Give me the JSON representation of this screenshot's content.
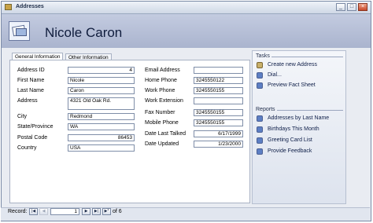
{
  "window": {
    "title": "Addresses"
  },
  "header": {
    "contact_name": "Nicole Caron"
  },
  "tabs": {
    "general": "General Information",
    "other": "Other Information"
  },
  "form_left": [
    {
      "label": "Address ID",
      "value": "4",
      "numeric": true
    },
    {
      "label": "First Name",
      "value": "Nicole"
    },
    {
      "label": "Last Name",
      "value": "Caron"
    },
    {
      "label": "Address",
      "value": "4321 Old Oak Rd."
    },
    {
      "label": "City",
      "value": "Redmond"
    },
    {
      "label": "State/Province",
      "value": "WA"
    },
    {
      "label": "Postal Code",
      "value": "86453",
      "numeric": true
    },
    {
      "label": "Country",
      "value": "USA"
    }
  ],
  "form_right": [
    {
      "label": "Email Address",
      "value": ""
    },
    {
      "label": "Home Phone",
      "value": "3245550122"
    },
    {
      "label": "Work Phone",
      "value": "3245550155"
    },
    {
      "label": "Work Extension",
      "value": ""
    },
    {
      "label": "Fax Number",
      "value": "3245550155"
    },
    {
      "label": "Mobile Phone",
      "value": "3245550155"
    },
    {
      "label": "Date Last Talked",
      "value": "6/17/1999",
      "numeric": true
    },
    {
      "label": "Date Updated",
      "value": "1/23/2000",
      "numeric": true
    }
  ],
  "tasks": {
    "heading": "Tasks",
    "items": [
      {
        "label": "Create new Address",
        "icon": "new-record-icon"
      },
      {
        "label": "Dial...",
        "icon": "dial-icon"
      },
      {
        "label": "Preview Fact Sheet",
        "icon": "preview-icon"
      }
    ]
  },
  "reports": {
    "heading": "Reports",
    "items": [
      {
        "label": "Addresses by Last Name",
        "icon": "report-icon"
      },
      {
        "label": "Birthdays This Month",
        "icon": "report-icon"
      },
      {
        "label": "Greeting Card List",
        "icon": "report-icon"
      },
      {
        "label": "Provide Feedback",
        "icon": "report-icon"
      }
    ]
  },
  "record_nav": {
    "label": "Record:",
    "current": "1",
    "of_total": "of  6",
    "first": "|◀",
    "prev": "◀",
    "next": "▶",
    "last": "▶|",
    "new": "▶*"
  },
  "window_buttons": {
    "minimize": "_",
    "maximize": "□",
    "close": "×"
  }
}
